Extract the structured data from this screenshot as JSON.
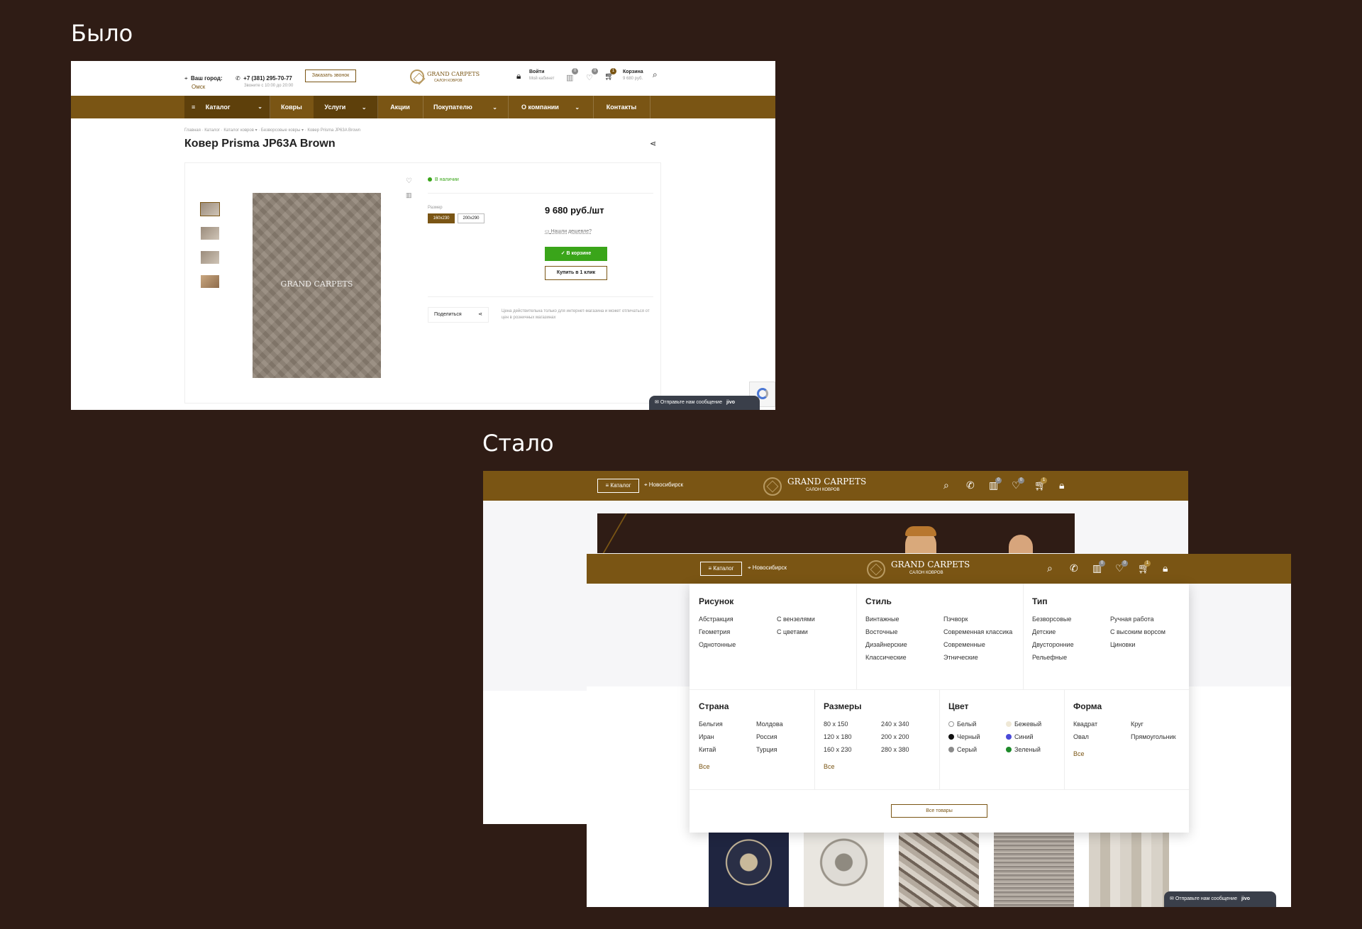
{
  "labels": {
    "before": "Было",
    "after": "Стало"
  },
  "old_site": {
    "header": {
      "city_label": "Ваш город:",
      "city_value": "Омск",
      "phone": "+7 (381) 295-70-77",
      "phone_hours": "Звоните с 10:00 до 20:00",
      "callback_button": "Заказать звонок",
      "logo_name": "GRAND CARPETS",
      "logo_sub": "САЛОН КОВРОВ",
      "login": "Войти",
      "login_sub": "Мой кабинет",
      "compare_count": "0",
      "favorites_count": "0",
      "cart_count": "1",
      "cart_label": "Корзина",
      "cart_sum": "9 680 руб."
    },
    "nav": [
      "Каталог",
      "Ковры",
      "Услуги",
      "Акции",
      "Покупателю",
      "О компании",
      "Контакты"
    ],
    "breadcrumb": [
      "Главная",
      "Каталог",
      "Каталог ковров",
      "Безворсовые ковры",
      "Ковер Prisma JP63A Brown"
    ],
    "product": {
      "title": "Ковер Prisma JP63A Brown",
      "image_watermark": "GRAND CARPETS",
      "stock": "В наличии",
      "size_label": "Размер",
      "sizes": [
        "160x230",
        "200x290"
      ],
      "price": "9 680 руб./шт",
      "cheaper": "Нашли дешевле?",
      "in_cart_button": "В корзине",
      "one_click_button": "Купить в 1 клик",
      "share": "Поделиться",
      "note": "Цена действительна только для интернет-магазина и может отличаться от цен в розничных магазинах"
    },
    "chat": {
      "label": "Отправьте нам сообщение",
      "brand": "jivo"
    }
  },
  "new_site": {
    "header": {
      "catalog_button": "Каталог",
      "city": "Новосибирск",
      "logo_name": "GRAND CARPETS",
      "logo_sub": "САЛОН КОВРОВ",
      "compare_count": "0",
      "favorites_count": "0",
      "cart_count": "1"
    },
    "menu": {
      "pattern": {
        "title": "Рисунок",
        "col1": [
          "Абстракция",
          "Геометрия",
          "Однотонные"
        ],
        "col2": [
          "С вензелями",
          "С цветами"
        ]
      },
      "style": {
        "title": "Стиль",
        "col1": [
          "Винтажные",
          "Восточные",
          "Дизайнерские",
          "Классические"
        ],
        "col2": [
          "Пэчворк",
          "Современная классика",
          "Современные",
          "Этнические"
        ]
      },
      "type": {
        "title": "Тип",
        "col1": [
          "Безворсовые",
          "Детские",
          "Двусторонние",
          "Рельефные"
        ],
        "col2": [
          "Ручная работа",
          "С высоким ворсом",
          "Циновки"
        ]
      },
      "country": {
        "title": "Страна",
        "col1": [
          "Бельгия",
          "Иран",
          "Китай"
        ],
        "col2": [
          "Молдова",
          "Россия",
          "Турция"
        ],
        "all": "Все"
      },
      "sizes": {
        "title": "Размеры",
        "col1": [
          "80 х 150",
          "120 х 180",
          "160 х 230"
        ],
        "col2": [
          "240 х 340",
          "200 х 200",
          "280 х 380"
        ],
        "all": "Все"
      },
      "color": {
        "title": "Цвет",
        "col1": [
          {
            "name": "Белый",
            "hex": "#ffffff"
          },
          {
            "name": "Черный",
            "hex": "#111111"
          },
          {
            "name": "Серый",
            "hex": "#8a8a8a"
          }
        ],
        "col2": [
          {
            "name": "Бежевый",
            "hex": "#efe8d6"
          },
          {
            "name": "Синий",
            "hex": "#4a4ad8"
          },
          {
            "name": "Зеленый",
            "hex": "#1e8a2a"
          }
        ]
      },
      "shape": {
        "title": "Форма",
        "col1": [
          "Квадрат",
          "Овал"
        ],
        "col2": [
          "Круг",
          "Прямоугольник"
        ],
        "all": "Все"
      },
      "all_products_button": "Все товары"
    },
    "chat": {
      "label": "Отправьте нам сообщение",
      "brand": "jivo"
    }
  },
  "colors": {
    "brand_brown": "#7a5514",
    "green": "#3aa51a",
    "background": "#2f1c15"
  }
}
